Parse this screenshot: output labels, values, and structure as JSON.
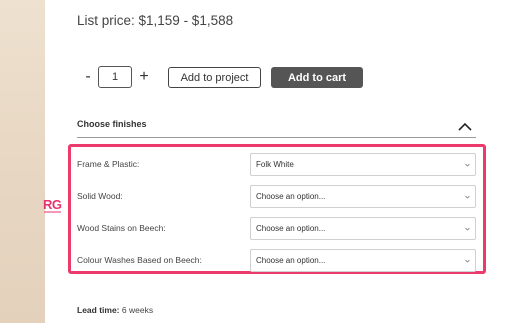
{
  "brand": {
    "logo_text": "RG",
    "accent": "#e8336d"
  },
  "pricing": {
    "list_price": "List price: $1,159 - $1,588"
  },
  "quantity": {
    "minus": "-",
    "value": "1",
    "plus": "+"
  },
  "actions": {
    "add_to_project": "Add to project",
    "add_to_cart": "Add to cart"
  },
  "finishes": {
    "title": "Choose finishes",
    "expanded": true,
    "options": [
      {
        "label": "Frame & Plastic:",
        "value": "Folk White"
      },
      {
        "label": "Solid Wood:",
        "value": "Choose an option..."
      },
      {
        "label": "Wood Stains on Beech:",
        "value": "Choose an option..."
      },
      {
        "label": "Colour Washes Based on Beech:",
        "value": "Choose an option..."
      }
    ]
  },
  "lead_time": {
    "label": "Lead time:",
    "value": "6",
    "unit": "weeks"
  },
  "colors": {
    "highlight": "#ec3a6c",
    "cart_button": "#555555",
    "side_panel": "#e8d8c4"
  }
}
